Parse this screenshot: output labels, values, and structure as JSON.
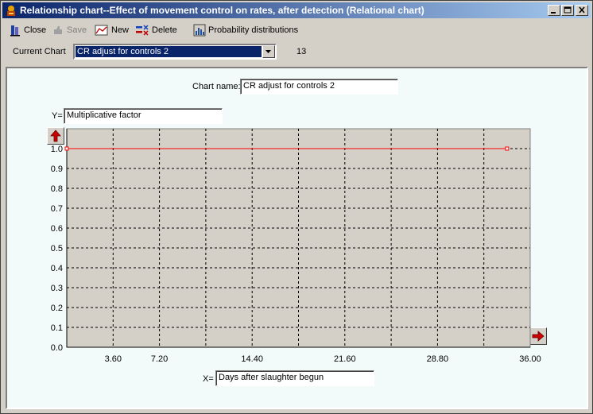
{
  "window": {
    "title": "Relationship chart--Effect of movement control on rates, after detection (Relational chart)"
  },
  "toolbar": {
    "close_label": "Close",
    "save_label": "Save",
    "new_label": "New",
    "delete_label": "Delete",
    "probability_label": "Probability distributions"
  },
  "current_chart": {
    "label": "Current Chart",
    "selected": "CR adjust for controls 2",
    "count": "13"
  },
  "chart_name": {
    "label": "Chart name:",
    "value": "CR adjust for controls 2"
  },
  "y_axis_field": {
    "label": "Y=",
    "value": "Multiplicative factor"
  },
  "x_axis_field": {
    "label": "X=",
    "value": "Days after slaughter begun"
  },
  "colors": {
    "plot_background": "#d4d0c8",
    "panel_background": "#f3fbfa",
    "series_line": "#ff0000",
    "arrow_red": "#cc0000"
  },
  "icons": [
    "app-icon",
    "close-icon",
    "save-icon",
    "new-chart-icon",
    "delete-icon",
    "probability-icon",
    "minimize-icon",
    "maximize-icon",
    "window-close-icon",
    "y-axis-up-arrow-icon",
    "x-axis-right-arrow-icon",
    "combo-dropdown-icon"
  ],
  "chart_data": {
    "type": "line",
    "title": "",
    "xlabel": "Days after slaughter begun",
    "ylabel": "Multiplicative factor",
    "xlim": [
      0,
      36
    ],
    "ylim": [
      0,
      1.0
    ],
    "x_ticks": [
      "3.60",
      "7.20",
      "14.40",
      "21.60",
      "28.80",
      "36.00"
    ],
    "x_tick_values": [
      3.6,
      7.2,
      14.4,
      21.6,
      28.8,
      36.0
    ],
    "x_grid_values": [
      3.6,
      7.2,
      10.8,
      14.4,
      18.0,
      21.6,
      25.2,
      28.8,
      32.4
    ],
    "y_ticks": [
      "0.0",
      "0.1",
      "0.2",
      "0.3",
      "0.4",
      "0.5",
      "0.6",
      "0.7",
      "0.8",
      "0.9",
      "1.0"
    ],
    "y_tick_values": [
      0,
      0.1,
      0.2,
      0.3,
      0.4,
      0.5,
      0.6,
      0.7,
      0.8,
      0.9,
      1.0
    ],
    "grid": true,
    "series": [
      {
        "x": [
          0,
          34.2
        ],
        "y": [
          1.0,
          1.0
        ]
      }
    ]
  }
}
